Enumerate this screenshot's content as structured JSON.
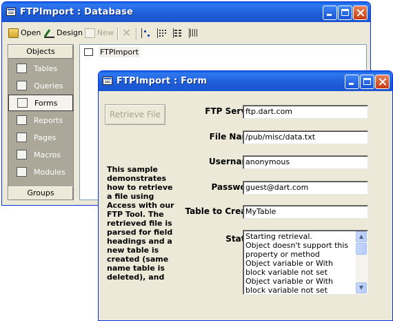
{
  "db_window": {
    "title": "FTPImport : Database",
    "toolbar": {
      "open_label": "Open",
      "design_label": "Design",
      "new_label": "New"
    },
    "objects_header": "Objects",
    "groups_header": "Groups",
    "nav_items": [
      {
        "label": "Tables",
        "icon": "table-icon"
      },
      {
        "label": "Queries",
        "icon": "query-icon"
      },
      {
        "label": "Forms",
        "icon": "form-icon",
        "selected": true
      },
      {
        "label": "Reports",
        "icon": "report-icon"
      },
      {
        "label": "Pages",
        "icon": "page-icon"
      },
      {
        "label": "Macros",
        "icon": "macro-icon"
      },
      {
        "label": "Modules",
        "icon": "module-icon"
      }
    ],
    "list_items": [
      "FTPImport"
    ]
  },
  "form_window": {
    "title": "FTPImport : Form",
    "retrieve_button": "Retrieve File",
    "labels": {
      "server": "FTP Server:",
      "file_name": "File Name:",
      "username": "Username:",
      "password": "Password:",
      "table": "Table to Create:",
      "status": "Status:"
    },
    "values": {
      "server": "ftp.dart.com",
      "file_name": "/pub/misc/data.txt",
      "username": "anonymous",
      "password": "guest@dart.com",
      "table": "MyTable"
    },
    "description": "This sample demonstrates how to retrieve a file using Access with our FTP Tool.  The retrieved file is parsed for field headings and a new table is created (same name table is deleted), and",
    "status_lines": [
      "Starting retrieval.",
      "Object doesn't support this property or method",
      "Object variable or With block variable not set",
      "Object variable or With block variable not set"
    ]
  },
  "colors": {
    "titlebar": "#1f5fd9",
    "window_face": "#ece9d8",
    "close_button": "#c83b13"
  }
}
